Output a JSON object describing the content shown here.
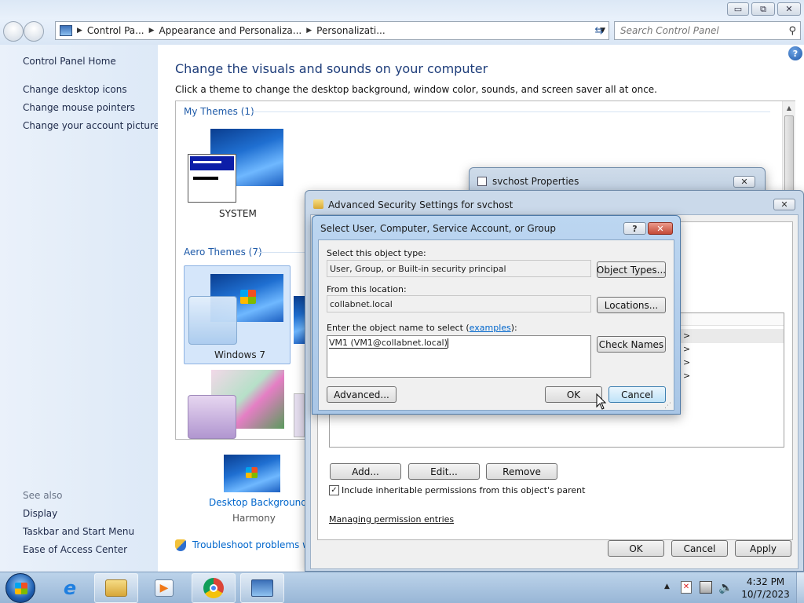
{
  "window_controls": {
    "minimize": "▭",
    "restore": "⧉",
    "close": "✕"
  },
  "address_bar": {
    "crumbs": [
      "Control Pa...",
      "Appearance and Personaliza...",
      "Personalizati..."
    ]
  },
  "search": {
    "placeholder": "Search Control Panel"
  },
  "sidebar": {
    "home": "Control Panel Home",
    "links": [
      "Change desktop icons",
      "Change mouse pointers",
      "Change your account picture"
    ],
    "see_also": "See also",
    "see_also_links": [
      "Display",
      "Taskbar and Start Menu",
      "Ease of Access Center"
    ]
  },
  "main": {
    "heading": "Change the visuals and sounds on your computer",
    "subtitle": "Click a theme to change the desktop background, window color, sounds, and screen saver all at once.",
    "my_themes_title": "My Themes (1)",
    "system_theme": "SYSTEM",
    "aero_title": "Aero Themes (7)",
    "windows7_theme": "Windows 7",
    "desktop_bg_label": "Desktop Background",
    "desktop_bg_value": "Harmony",
    "troubleshoot": "Troubleshoot problems wit"
  },
  "svchost_props": {
    "title": "svchost Properties"
  },
  "adv_security": {
    "title": "Advanced Security Settings for svchost",
    "add": "Add...",
    "edit": "Edit...",
    "remove": "Remove",
    "inherit_label": "Include inheritable permissions from this object's parent",
    "managing_link": "Managing permission entries",
    "ok": "OK",
    "cancel": "Cancel",
    "apply": "Apply"
  },
  "select_dialog": {
    "title": "Select User, Computer, Service Account, or Group",
    "object_type_label": "Select this object type:",
    "object_type_value": "User, Group, or Built-in security principal",
    "object_types_btn": "Object Types...",
    "location_label": "From this location:",
    "location_value": "collabnet.local",
    "locations_btn": "Locations...",
    "enter_label_pre": "Enter the object name to select (",
    "enter_label_link": "examples",
    "enter_label_post": "):",
    "object_name": "VM1 (VM1@collabnet.local)",
    "check_names_btn": "Check Names",
    "advanced_btn": "Advanced...",
    "ok_btn": "OK",
    "cancel_btn": "Cancel"
  },
  "taskbar": {
    "time": "4:32 PM",
    "date": "10/7/2023"
  }
}
